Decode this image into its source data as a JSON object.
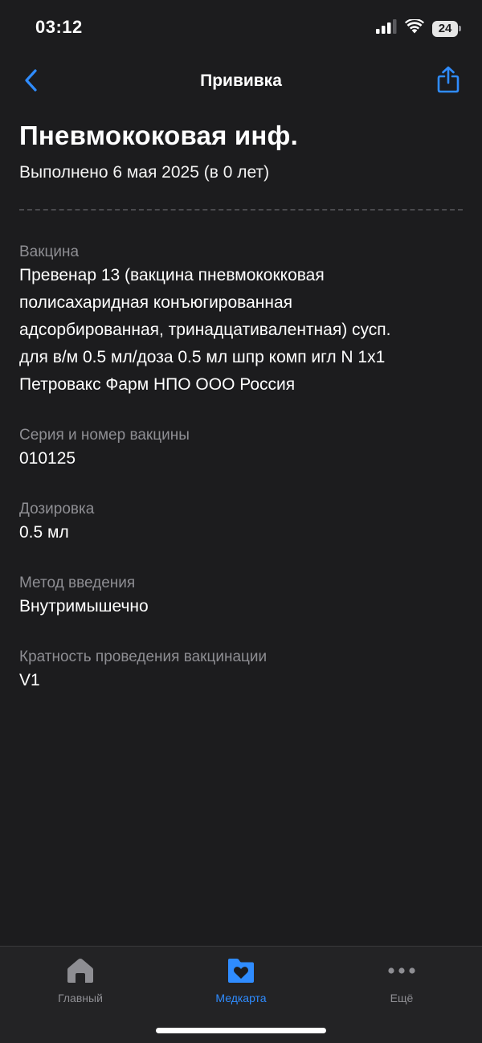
{
  "status_bar": {
    "time": "03:12",
    "battery": "24",
    "icons": [
      "signal-icon",
      "wifi-icon",
      "battery-icon"
    ]
  },
  "nav": {
    "title": "Прививка",
    "back_icon": "chevron-left-icon",
    "share_icon": "share-icon"
  },
  "header": {
    "title": "Пневмококовая инф.",
    "subtitle": "Выполнено 6 мая 2025 (в 0 лет)"
  },
  "fields": [
    {
      "label": "Вакцина",
      "value": "Превенар 13 (вакцина пневмококковая\nполисахаридная конъюгированная\nадсорбированная, тринадцативалентная) сусп.\nдля в/м 0.5 мл/доза 0.5 мл шпр комп игл N 1x1\nПетровакс Фарм НПО ООО Россия"
    },
    {
      "label": "Серия и номер вакцины",
      "value": "010125"
    },
    {
      "label": "Дозировка",
      "value": "0.5 мл"
    },
    {
      "label": "Метод введения",
      "value": "Внутримышечно"
    },
    {
      "label": "Кратность проведения вакцинации",
      "value": "V1"
    }
  ],
  "tab_bar": {
    "tabs": [
      {
        "label": "Главный",
        "icon": "home-icon",
        "active": false
      },
      {
        "label": "Медкарта",
        "icon": "medcard-heart-icon",
        "active": true
      },
      {
        "label": "Ещё",
        "icon": "more-dots-icon",
        "active": false
      }
    ]
  },
  "colors": {
    "background": "#1c1c1e",
    "accent": "#2f8cff",
    "secondary_text": "#8e8e93",
    "tab_inactive": "#8e8e93"
  }
}
